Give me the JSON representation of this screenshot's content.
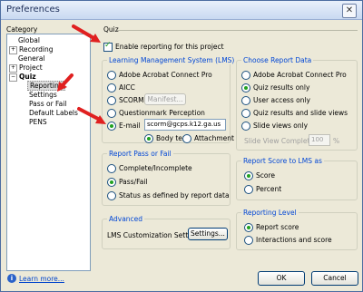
{
  "window": {
    "title": "Preferences",
    "close_label": "✕"
  },
  "category": {
    "label": "Category",
    "items": [
      {
        "label": "Global",
        "indent": 0,
        "expander": ""
      },
      {
        "label": "Recording",
        "indent": 0,
        "expander": "+"
      },
      {
        "label": "General",
        "indent": 0,
        "expander": ""
      },
      {
        "label": "Project",
        "indent": 0,
        "expander": "+"
      },
      {
        "label": "Quiz",
        "indent": 0,
        "expander": "−"
      },
      {
        "label": "Reporting",
        "indent": 1,
        "expander": ""
      },
      {
        "label": "Settings",
        "indent": 1,
        "expander": ""
      },
      {
        "label": "Pass or Fail",
        "indent": 1,
        "expander": ""
      },
      {
        "label": "Default Labels",
        "indent": 1,
        "expander": ""
      },
      {
        "label": "PENS",
        "indent": 1,
        "expander": ""
      }
    ]
  },
  "quiz": {
    "heading": "Quiz",
    "enable_reporting": "Enable reporting for this project"
  },
  "lms": {
    "title": "Learning Management System (LMS)",
    "options": [
      "Adobe Acrobat Connect Pro",
      "AICC",
      "SCORM",
      "Questionmark Perception",
      "E-mail"
    ],
    "manifest_button": "Manifest...",
    "email_value": "scorm@gcps.k12.ga.us",
    "body_text": "Body text",
    "attachment": "Attachment"
  },
  "pass_fail": {
    "title": "Report Pass or Fail",
    "options": [
      "Complete/Incomplete",
      "Pass/Fail",
      "Status as defined by report data"
    ]
  },
  "advanced": {
    "title": "Advanced",
    "lms_label": "LMS Customization Settings",
    "settings_button": "Settings..."
  },
  "report_data": {
    "title": "Choose Report Data",
    "options": [
      "Adobe Acrobat Connect Pro",
      "Quiz results only",
      "User access only",
      "Quiz results and slide views",
      "Slide views only"
    ],
    "slide_view_label": "Slide View Completion:",
    "slide_view_value": "100",
    "percent": "%"
  },
  "score_to_lms": {
    "title": "Report Score to LMS as",
    "options": [
      "Score",
      "Percent"
    ]
  },
  "reporting_level": {
    "title": "Reporting Level",
    "options": [
      "Report score",
      "Interactions and score"
    ]
  },
  "footer": {
    "learn_more": "Learn more...",
    "ok": "OK",
    "cancel": "Cancel"
  },
  "colors": {
    "arrow": "#e02020",
    "check": "#21a121",
    "group_title": "#0046d5"
  }
}
